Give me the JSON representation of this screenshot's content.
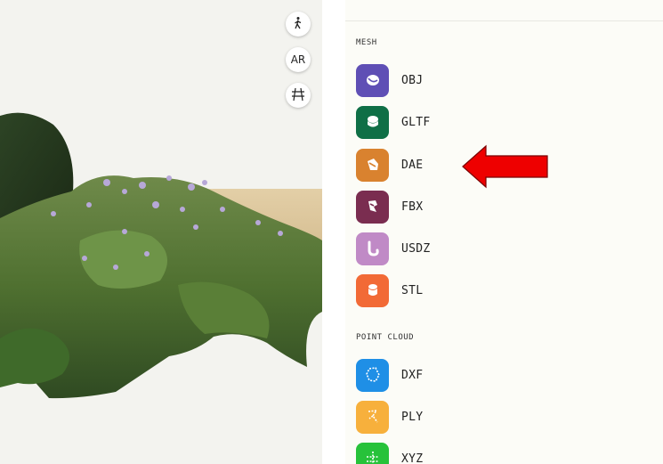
{
  "viewer": {
    "tools": [
      {
        "icon": "walk-icon",
        "label": ""
      },
      {
        "icon": "ar-icon",
        "label": "AR"
      },
      {
        "icon": "grid-icon",
        "label": ""
      }
    ]
  },
  "panel": {
    "sections": [
      {
        "title": "MESH",
        "items": [
          {
            "label": "OBJ",
            "color": "#5f4fb5"
          },
          {
            "label": "GLTF",
            "color": "#0f6f46"
          },
          {
            "label": "DAE",
            "color": "#d9822f"
          },
          {
            "label": "FBX",
            "color": "#7a2d50"
          },
          {
            "label": "USDZ",
            "color": "#c08ac6"
          },
          {
            "label": "STL",
            "color": "#f26a36"
          }
        ]
      },
      {
        "title": "POINT CLOUD",
        "items": [
          {
            "label": "DXF",
            "color": "#1f8fe6"
          },
          {
            "label": "PLY",
            "color": "#f7b03c"
          },
          {
            "label": "XYZ",
            "color": "#27c23a"
          }
        ]
      }
    ]
  },
  "annotation": {
    "arrow_color": "#ee0000",
    "points_to": "DAE"
  }
}
